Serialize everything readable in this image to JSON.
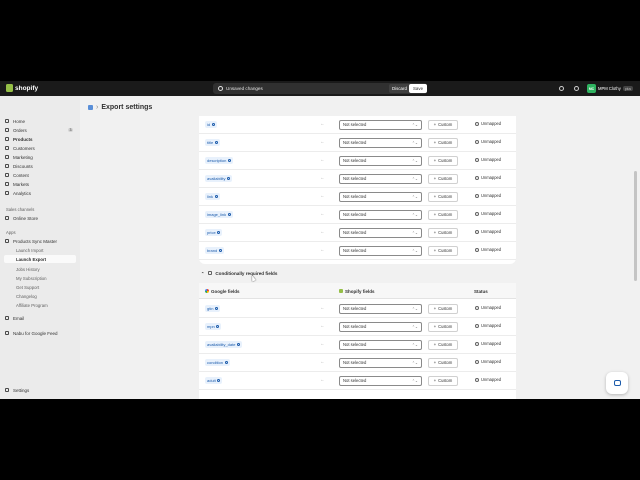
{
  "topbar": {
    "brand": "shopify",
    "unsaved_text": "Unsaved changes",
    "discard_label": "Discard",
    "save_label": "Save",
    "store_initials": "MC",
    "store_name": "MPM Clothy",
    "store_tag": "plus"
  },
  "sidebar": {
    "items": [
      {
        "label": "Home"
      },
      {
        "label": "Orders",
        "badge": "3"
      },
      {
        "label": "Products"
      },
      {
        "label": "Customers"
      },
      {
        "label": "Marketing"
      },
      {
        "label": "Discounts"
      },
      {
        "label": "Content"
      },
      {
        "label": "Markets"
      },
      {
        "label": "Analytics"
      }
    ],
    "sales_channels_label": "Sales channels",
    "online_store_label": "Online Store",
    "apps_label": "Apps",
    "app_name": "Products Sync Master",
    "app_subitems": [
      "Launch Import",
      "Launch Export",
      "Jobs History",
      "My Subscription",
      "Get Support",
      "Changelog",
      "Affiliate Program"
    ],
    "email_label": "Email",
    "nabu_label": "Nabu for Google Feed",
    "settings_label": "Settings"
  },
  "page": {
    "title": "Export settings"
  },
  "common": {
    "select_value": "Not selected",
    "custom_label": "Custom",
    "status_value": "Unmapped"
  },
  "required_rows": [
    "id",
    "title",
    "description",
    "availability",
    "link",
    "image_link",
    "price",
    "brand"
  ],
  "conditional": {
    "title": "Conditionally required fields",
    "col_google": "Google fields",
    "col_shopify": "Shopify fields",
    "col_status": "Status",
    "rows": [
      "gtin",
      "mpn",
      "availability_date",
      "condition",
      "adult"
    ]
  }
}
